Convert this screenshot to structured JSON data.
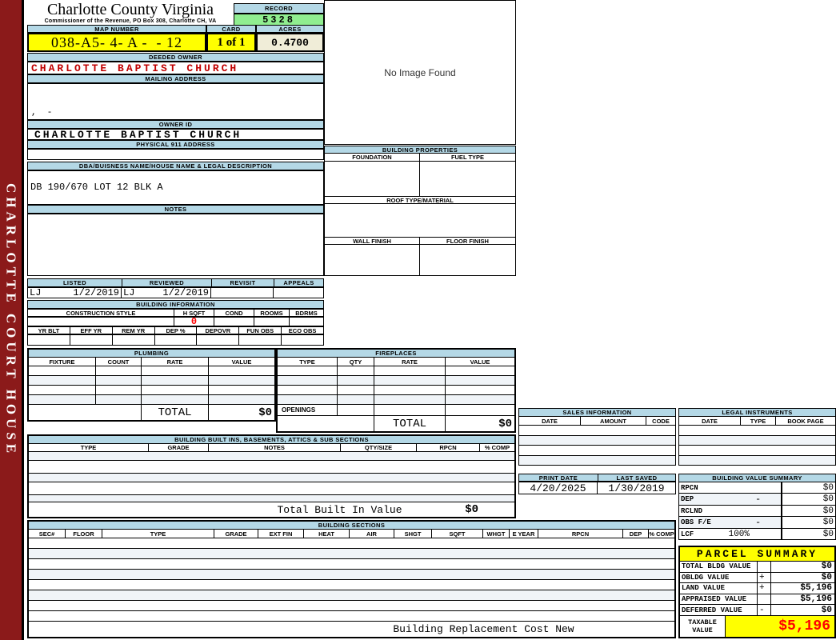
{
  "colors": {
    "maroon": "#8B1A1A",
    "header_blue": "#B4D8E6",
    "record_green": "#90EE90",
    "highlight_yellow": "#FFFF00",
    "acres_cream": "#F0EDD8",
    "owner_red": "#C00000",
    "value_red": "#FF0000",
    "row_alt": "#F0F4F8"
  },
  "sidebar": {
    "title": "CHARLOTTE COURT HOUSE"
  },
  "header": {
    "county": "Charlotte County Virginia",
    "commissioner": "Commissioner of the Revenue, PO Box 308, Charlotte CH, VA",
    "record_label": "RECORD",
    "record_value": "5328",
    "map_label": "MAP NUMBER",
    "map_value": "038-A5- 4- A -  - 12",
    "card_label": "CARD",
    "card_value": "1 of 1",
    "acres_label": "ACRES",
    "acres_value": "0.4700"
  },
  "owner": {
    "deeded_label": "DEEDED OWNER",
    "deeded_value": "CHARLOTTE BAPTIST CHURCH",
    "mailing_label": "MAILING ADDRESS",
    "mailing_value": ",  -",
    "owner_id_label": "OWNER ID",
    "owner_id_value": "CHARLOTTE BAPTIST CHURCH",
    "physical_label": "PHYSICAL 911 ADDRESS",
    "physical_value": ""
  },
  "dba": {
    "label": "DBA/BUISNESS NAME/HOUSE NAME & LEGAL DESCRIPTION",
    "value": "DB 190/670 LOT 12 BLK A"
  },
  "notes": {
    "label": "NOTES",
    "value": ""
  },
  "review": {
    "columns": [
      "LISTED",
      "REVIEWED",
      "REVISIT",
      "APPEALS"
    ],
    "listed_by": "LJ",
    "listed_date": "1/2/2019",
    "reviewed_by": "LJ",
    "reviewed_date": "1/2/2019",
    "revisit": "",
    "appeals": ""
  },
  "building_information": {
    "title": "BUILDING INFORMATION",
    "columns1": [
      "CONSTRUCTION STYLE",
      "H SQFT",
      "COND",
      "ROOMS",
      "BDRMS"
    ],
    "h_sqft": "0",
    "columns2": [
      "YR BLT",
      "EFF YR",
      "REM YR",
      "DEP %",
      "DEPOVR",
      "FUN OBS",
      "ECO OBS"
    ]
  },
  "no_image": {
    "text": "No Image Found"
  },
  "building_properties": {
    "title": "BUILDING PROPERTIES",
    "foundation": "FOUNDATION",
    "fuel_type": "FUEL TYPE",
    "roof": "ROOF TYPE/MATERIAL",
    "wall_finish": "WALL FINISH",
    "floor_finish": "FLOOR FINISH"
  },
  "plumbing": {
    "title": "PLUMBING",
    "columns": [
      "FIXTURE",
      "COUNT",
      "RATE",
      "VALUE"
    ],
    "total_label": "TOTAL",
    "total_value": "$0"
  },
  "fireplaces": {
    "title": "FIREPLACES",
    "columns": [
      "TYPE",
      "QTY",
      "RATE",
      "VALUE"
    ],
    "openings_label": "OPENINGS",
    "total_label": "TOTAL",
    "total_value": "$0"
  },
  "built_ins": {
    "title": "BUILDING BUILT INS, BASEMENTS, ATTICS & SUB SECTIONS",
    "columns": [
      "TYPE",
      "GRADE",
      "NOTES",
      "QTY/SIZE",
      "RPCN",
      "% COMP"
    ],
    "total_label": "Total Built In Value",
    "total_value": "$0"
  },
  "building_sections": {
    "title": "BUILDING SECTIONS",
    "columns": [
      "SEC#",
      "FLOOR",
      "TYPE",
      "GRADE",
      "EXT FIN",
      "HEAT",
      "AIR",
      "SHGT",
      "SQFT",
      "WHGT",
      "E YEAR",
      "RPCN",
      "DEP",
      "% COMP"
    ],
    "footer": "Building Replacement Cost New"
  },
  "sales_information": {
    "title": "SALES INFORMATION",
    "columns": [
      "DATE",
      "AMOUNT",
      "CODE"
    ]
  },
  "legal_instruments": {
    "title": "LEGAL INSTRUMENTS",
    "columns": [
      "DATE",
      "TYPE",
      "BOOK PAGE"
    ]
  },
  "print_info": {
    "print_date_label": "PRINT DATE",
    "print_date": "4/20/2025",
    "last_saved_label": "LAST SAVED",
    "last_saved": "1/30/2019"
  },
  "building_value_summary": {
    "title": "BUILDING VALUE SUMMARY",
    "rows": [
      {
        "label": "RPCN",
        "op": "",
        "value": "$0"
      },
      {
        "label": "DEP",
        "op": "-",
        "value": "$0"
      },
      {
        "label": "RCLND",
        "op": "",
        "value": "$0"
      },
      {
        "label": "OBS F/E",
        "op": "-",
        "value": "$0"
      },
      {
        "label": "LCF",
        "pct": "100%",
        "op": "",
        "value": "$0"
      }
    ]
  },
  "parcel_summary": {
    "title": "PARCEL SUMMARY",
    "rows": [
      {
        "label": "TOTAL BLDG VALUE",
        "op": "",
        "value": "$0"
      },
      {
        "label": "OBLDG VALUE",
        "op": "+",
        "value": "$0"
      },
      {
        "label": "LAND VALUE",
        "op": "+",
        "value": "$5,196"
      },
      {
        "label": "APPRAISED VALUE",
        "op": "",
        "value": "$5,196"
      },
      {
        "label": "DEFERRED VALUE",
        "op": "-",
        "value": "$0"
      }
    ],
    "taxable_label": "TAXABLE VALUE",
    "taxable_value": "$5,196"
  }
}
